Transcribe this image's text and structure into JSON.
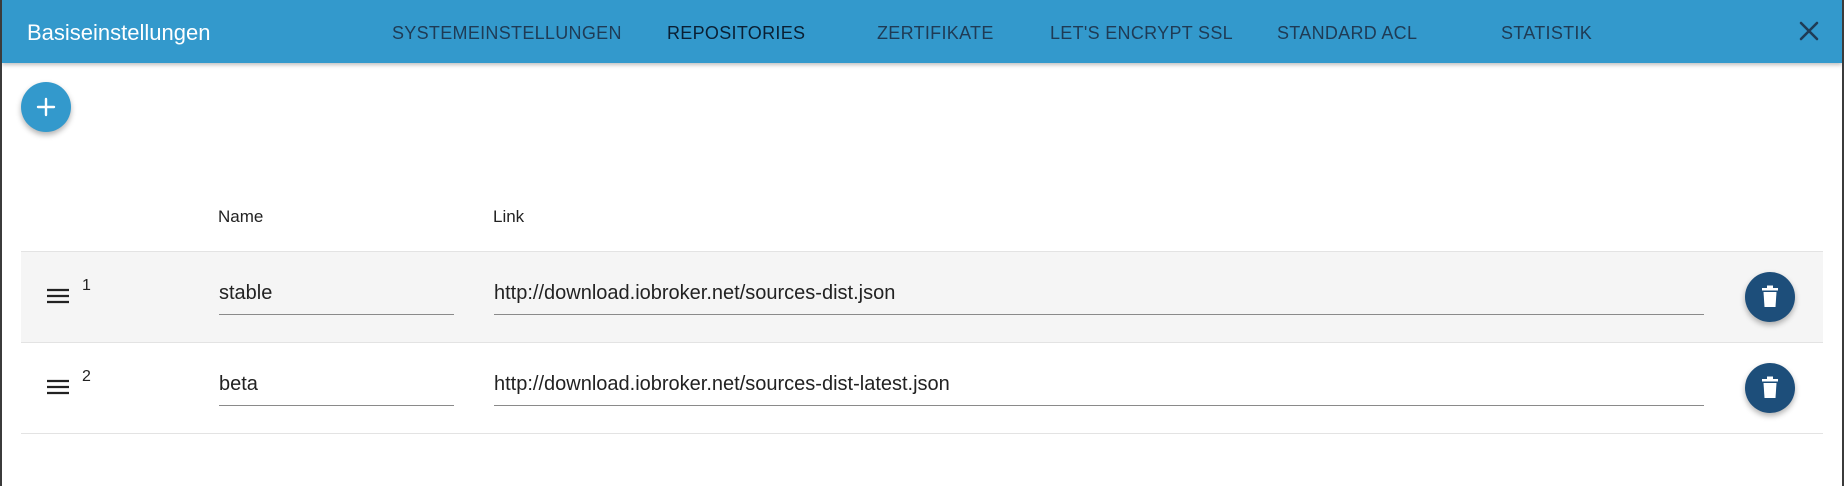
{
  "header": {
    "title": "Basiseinstellungen",
    "tabs": [
      {
        "label": "SYSTEMEINSTELLUNGEN"
      },
      {
        "label": "REPOSITORIES"
      },
      {
        "label": "ZERTIFIKATE"
      },
      {
        "label": "LET'S ENCRYPT SSL"
      },
      {
        "label": "STANDARD ACL"
      },
      {
        "label": "STATISTIK"
      }
    ],
    "active_tab": "REPOSITORIES",
    "close_icon": "close-icon"
  },
  "table": {
    "columns": {
      "name": "Name",
      "link": "Link"
    },
    "rows": [
      {
        "index": "1",
        "name": "stable",
        "link": "http://download.iobroker.net/sources-dist.json"
      },
      {
        "index": "2",
        "name": "beta",
        "link": "http://download.iobroker.net/sources-dist-latest.json"
      }
    ]
  },
  "colors": {
    "appbar": "#3399cc",
    "fab": "#3399cc",
    "delete_button": "#1d4e7a",
    "row_highlight": "#f5f5f5"
  }
}
